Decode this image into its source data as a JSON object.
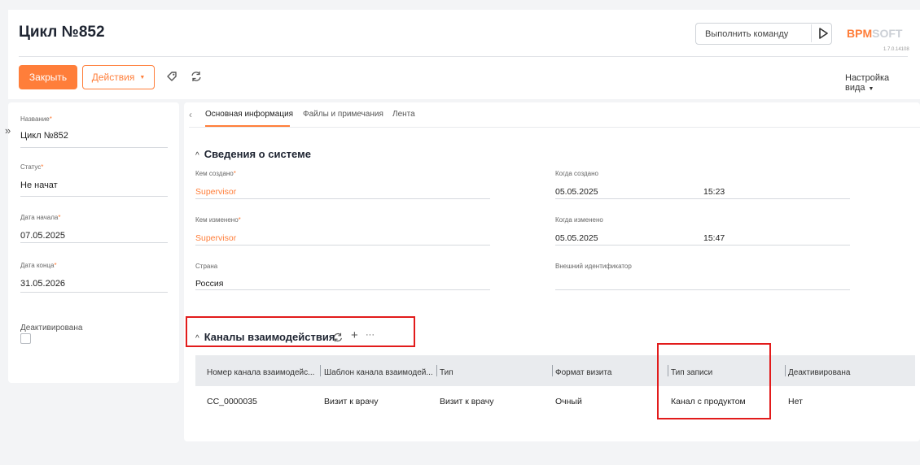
{
  "header": {
    "title": "Цикл №852",
    "command_placeholder": "Выполнить команду",
    "logo_main": "BPM",
    "logo_soft": "SOFT",
    "version": "1.7.0.14108",
    "view_settings": "Настройка вида"
  },
  "toolbar": {
    "close_label": "Закрыть",
    "actions_label": "Действия"
  },
  "left_panel": {
    "fields": [
      {
        "label": "Название",
        "value": "Цикл №852"
      },
      {
        "label": "Статус",
        "value": "Не начат"
      },
      {
        "label": "Дата начала",
        "value": "07.05.2025"
      },
      {
        "label": "Дата конца",
        "value": "31.05.2026"
      }
    ],
    "deactivated_label": "Деактивирована",
    "deactivated_checked": false
  },
  "tabs": [
    {
      "label": "Основная информация",
      "active": true
    },
    {
      "label": "Файлы и примечания",
      "active": false
    },
    {
      "label": "Лента",
      "active": false
    }
  ],
  "system_section": {
    "title": "Сведения о системе",
    "created_by_label": "Кем создано",
    "created_by_value": "Supervisor",
    "created_on_label": "Когда создано",
    "created_on_date": "05.05.2025",
    "created_on_time": "15:23",
    "modified_by_label": "Кем изменено",
    "modified_by_value": "Supervisor",
    "modified_on_label": "Когда изменено",
    "modified_on_date": "05.05.2025",
    "modified_on_time": "15:47",
    "country_label": "Страна",
    "country_value": "Россия",
    "external_id_label": "Внешний идентификатор",
    "external_id_value": ""
  },
  "channels_section": {
    "title": "Каналы взаимодействия",
    "columns": [
      "Номер канала взаимодейс...",
      "Шаблон канала взаимодей...",
      "Тип",
      "Формат визита",
      "Тип записи",
      "Деактивирована"
    ],
    "rows": [
      [
        "CC_0000035",
        "Визит к врачу",
        "Визит к врачу",
        "Очный",
        "Канал с продуктом",
        "Нет"
      ]
    ]
  },
  "colors": {
    "accent": "#ff7e3a",
    "highlight": "#e21b1b"
  }
}
